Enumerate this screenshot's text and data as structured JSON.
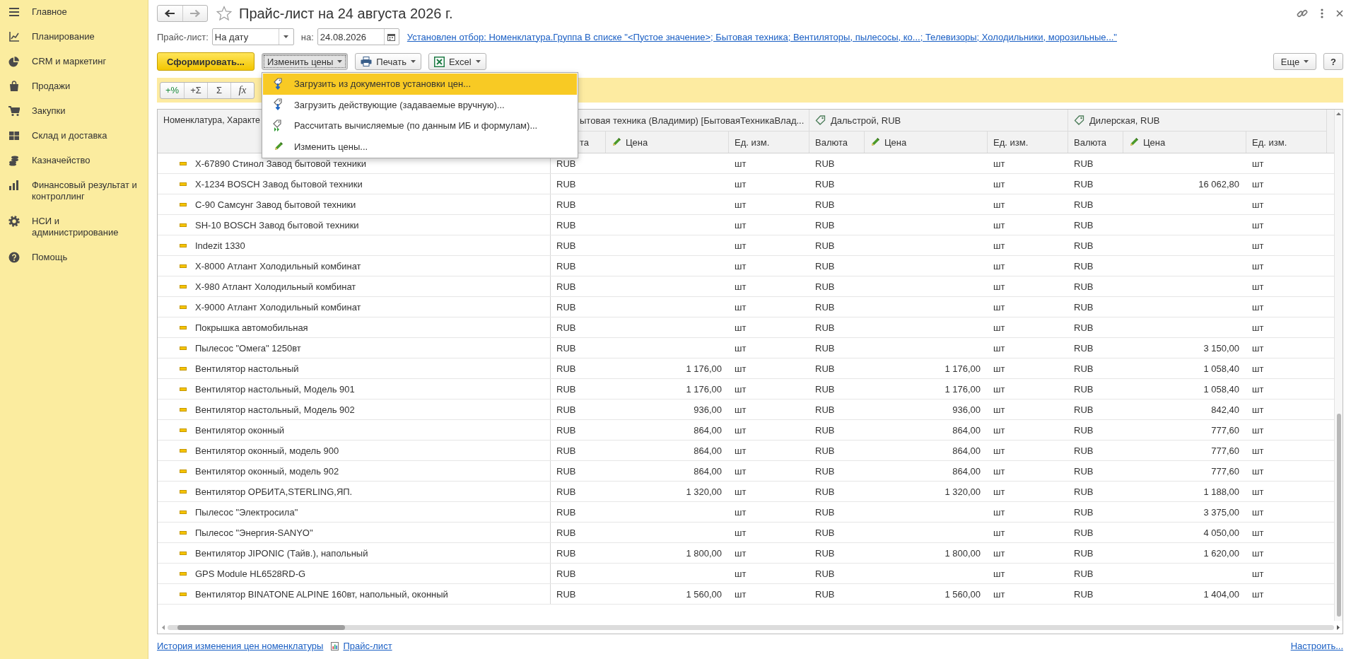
{
  "sidebar": {
    "items": [
      {
        "label": "Главное",
        "selected": false
      },
      {
        "label": "Планирование",
        "selected": false
      },
      {
        "label": "CRM и маркетинг",
        "selected": false
      },
      {
        "label": "Продажи",
        "selected": false
      },
      {
        "label": "Закупки",
        "selected": false
      },
      {
        "label": "Склад и доставка",
        "selected": false
      },
      {
        "label": "Казначейство",
        "selected": false
      },
      {
        "label": "Финансовый результат и контроллинг",
        "selected": false
      },
      {
        "label": "НСИ и администрирование",
        "selected": false
      },
      {
        "label": "Помощь",
        "selected": false
      }
    ]
  },
  "form": {
    "nav": [
      {
        "kind": "back",
        "disabled": false
      },
      {
        "kind": "forward",
        "disabled": true
      }
    ],
    "favorite": false,
    "title": "Прайс-лист на 24 августа 2026 г.",
    "filter": {
      "label": "Прайс-лист:",
      "value": "На дату",
      "date_label": "на:",
      "date": "24.08.2026",
      "link": "Установлен отбор: Номенклатура.Группа В списке \"<Пустое значение>; Бытовая техника; Вентиляторы, пылесосы, ко...; Телевизоры; Холодильники, морозильные...\""
    },
    "toolbar": [
      {
        "kind": "primary",
        "label": "Сформировать...",
        "pressed": false
      },
      {
        "kind": "menu",
        "label": "Изменить цены",
        "pressed": true
      },
      {
        "kind": "print",
        "label": "Печать",
        "pressed": false
      },
      {
        "kind": "excel",
        "label": "Excel",
        "pressed": false
      }
    ],
    "toolbar_right": [
      {
        "kind": "menu",
        "label": "Еще",
        "pressed": false
      },
      {
        "kind": "plain",
        "label": "?",
        "pressed": false
      }
    ],
    "calc_buttons": [
      {
        "kind": "percent",
        "label": "+%"
      },
      {
        "kind": "sum",
        "label": "+Σ"
      },
      {
        "kind": "sum",
        "label": "Σ"
      },
      {
        "kind": "formula",
        "label": "fx"
      }
    ]
  },
  "table": {
    "name_header": "Номенклатура, Характе",
    "groups": [
      {
        "title": "ытовая техника (Владимир) [БытоваяТехникаВлад...",
        "icon": false,
        "columns": [
          "та",
          "Цена",
          "Ед. изм."
        ]
      },
      {
        "title": "Дальстрой, RUB",
        "icon": true,
        "columns": [
          "Валюта",
          "Цена",
          "Ед. изм."
        ]
      },
      {
        "title": "Дилерская, RUB",
        "icon": true,
        "columns": [
          "Валюта",
          "Цена",
          "Ед. изм."
        ]
      }
    ],
    "rows": [
      {
        "name": "X-67890 Стинол Завод бытовой техники",
        "prices": [
          {
            "currency": "RUB",
            "unit": "шт"
          },
          {
            "currency": "RUB",
            "unit": "шт"
          },
          {
            "currency": "RUB",
            "unit": "шт"
          }
        ]
      },
      {
        "name": "X-1234 BOSCH Завод бытовой техники",
        "prices": [
          {
            "currency": "RUB",
            "unit": "шт"
          },
          {
            "currency": "RUB",
            "unit": "шт"
          },
          {
            "currency": "RUB",
            "price": "16 062,80",
            "unit": "шт"
          }
        ]
      },
      {
        "name": "C-90 Самсунг Завод бытовой техники",
        "prices": [
          {
            "currency": "RUB",
            "unit": "шт"
          },
          {
            "currency": "RUB",
            "unit": "шт"
          },
          {
            "currency": "RUB",
            "unit": "шт"
          }
        ]
      },
      {
        "name": "SH-10 BOSCH Завод бытовой техники",
        "prices": [
          {
            "currency": "RUB",
            "unit": "шт"
          },
          {
            "currency": "RUB",
            "unit": "шт"
          },
          {
            "currency": "RUB",
            "unit": "шт"
          }
        ]
      },
      {
        "name": "Indezit 1330",
        "prices": [
          {
            "currency": "RUB",
            "unit": "шт"
          },
          {
            "currency": "RUB",
            "unit": "шт"
          },
          {
            "currency": "RUB",
            "unit": "шт"
          }
        ]
      },
      {
        "name": "X-8000 Атлант Холодильный комбинат",
        "prices": [
          {
            "currency": "RUB",
            "unit": "шт"
          },
          {
            "currency": "RUB",
            "unit": "шт"
          },
          {
            "currency": "RUB",
            "unit": "шт"
          }
        ]
      },
      {
        "name": "X-980 Атлант Холодильный комбинат",
        "prices": [
          {
            "currency": "RUB",
            "unit": "шт"
          },
          {
            "currency": "RUB",
            "unit": "шт"
          },
          {
            "currency": "RUB",
            "unit": "шт"
          }
        ]
      },
      {
        "name": "X-9000 Атлант Холодильный комбинат",
        "prices": [
          {
            "currency": "RUB",
            "unit": "шт"
          },
          {
            "currency": "RUB",
            "unit": "шт"
          },
          {
            "currency": "RUB",
            "unit": "шт"
          }
        ]
      },
      {
        "name": "Покрышка автомобильная",
        "prices": [
          {
            "currency": "RUB",
            "unit": "шт"
          },
          {
            "currency": "RUB",
            "unit": "шт"
          },
          {
            "currency": "RUB",
            "unit": "шт"
          }
        ]
      },
      {
        "name": "Пылесос \"Омега\" 1250вт",
        "prices": [
          {
            "currency": "RUB",
            "unit": "шт"
          },
          {
            "currency": "RUB",
            "unit": "шт"
          },
          {
            "currency": "RUB",
            "price": "3 150,00",
            "unit": "шт"
          }
        ]
      },
      {
        "name": "Вентилятор настольный",
        "prices": [
          {
            "currency": "RUB",
            "price": "1 176,00",
            "unit": "шт"
          },
          {
            "currency": "RUB",
            "price": "1 176,00",
            "unit": "шт"
          },
          {
            "currency": "RUB",
            "price": "1 058,40",
            "unit": "шт"
          }
        ]
      },
      {
        "name": "Вентилятор настольный, Модель 901",
        "prices": [
          {
            "currency": "RUB",
            "price": "1 176,00",
            "unit": "шт"
          },
          {
            "currency": "RUB",
            "price": "1 176,00",
            "unit": "шт"
          },
          {
            "currency": "RUB",
            "price": "1 058,40",
            "unit": "шт"
          }
        ]
      },
      {
        "name": "Вентилятор настольный, Модель 902",
        "prices": [
          {
            "currency": "RUB",
            "price": "936,00",
            "unit": "шт"
          },
          {
            "currency": "RUB",
            "price": "936,00",
            "unit": "шт"
          },
          {
            "currency": "RUB",
            "price": "842,40",
            "unit": "шт"
          }
        ]
      },
      {
        "name": "Вентилятор оконный",
        "prices": [
          {
            "currency": "RUB",
            "price": "864,00",
            "unit": "шт"
          },
          {
            "currency": "RUB",
            "price": "864,00",
            "unit": "шт"
          },
          {
            "currency": "RUB",
            "price": "777,60",
            "unit": "шт"
          }
        ]
      },
      {
        "name": "Вентилятор оконный, модель 900",
        "prices": [
          {
            "currency": "RUB",
            "price": "864,00",
            "unit": "шт"
          },
          {
            "currency": "RUB",
            "price": "864,00",
            "unit": "шт"
          },
          {
            "currency": "RUB",
            "price": "777,60",
            "unit": "шт"
          }
        ]
      },
      {
        "name": "Вентилятор оконный, модель 902",
        "prices": [
          {
            "currency": "RUB",
            "price": "864,00",
            "unit": "шт"
          },
          {
            "currency": "RUB",
            "price": "864,00",
            "unit": "шт"
          },
          {
            "currency": "RUB",
            "price": "777,60",
            "unit": "шт"
          }
        ]
      },
      {
        "name": "Вентилятор ОРБИТА,STERLING,ЯП.",
        "prices": [
          {
            "currency": "RUB",
            "price": "1 320,00",
            "unit": "шт"
          },
          {
            "currency": "RUB",
            "price": "1 320,00",
            "unit": "шт"
          },
          {
            "currency": "RUB",
            "price": "1 188,00",
            "unit": "шт"
          }
        ]
      },
      {
        "name": "Пылесос \"Электросила\"",
        "prices": [
          {
            "currency": "RUB",
            "unit": "шт"
          },
          {
            "currency": "RUB",
            "unit": "шт"
          },
          {
            "currency": "RUB",
            "price": "3 375,00",
            "unit": "шт"
          }
        ]
      },
      {
        "name": "Пылесос \"Энергия-SANYO\"",
        "prices": [
          {
            "currency": "RUB",
            "unit": "шт"
          },
          {
            "currency": "RUB",
            "unit": "шт"
          },
          {
            "currency": "RUB",
            "price": "4 050,00",
            "unit": "шт"
          }
        ]
      },
      {
        "name": "Вентилятор JIPONIC (Тайв.), напольный",
        "prices": [
          {
            "currency": "RUB",
            "price": "1 800,00",
            "unit": "шт"
          },
          {
            "currency": "RUB",
            "price": "1 800,00",
            "unit": "шт"
          },
          {
            "currency": "RUB",
            "price": "1 620,00",
            "unit": "шт"
          }
        ]
      },
      {
        "name": "GPS Module HL6528RD-G",
        "prices": [
          {
            "currency": "RUB",
            "unit": "шт"
          },
          {
            "currency": "RUB",
            "unit": "шт"
          },
          {
            "currency": "RUB",
            "unit": "шт"
          }
        ]
      },
      {
        "name": "Вентилятор BINATONE ALPINE 160вт, напольный, оконный",
        "prices": [
          {
            "currency": "RUB",
            "price": "1 560,00",
            "unit": "шт"
          },
          {
            "currency": "RUB",
            "price": "1 560,00",
            "unit": "шт"
          },
          {
            "currency": "RUB",
            "price": "1 404,00",
            "unit": "шт"
          }
        ]
      }
    ]
  },
  "menu": {
    "items": [
      {
        "kind": "load",
        "label": "Загрузить из документов установки цен...",
        "selected": true
      },
      {
        "kind": "load",
        "label": "Загрузить действующие (задаваемые вручную)...",
        "selected": false
      },
      {
        "kind": "calculate",
        "label": "Рассчитать вычисляемые (по данным ИБ и формулам)...",
        "selected": false
      },
      {
        "kind": "edit",
        "label": "Изменить цены...",
        "selected": false
      }
    ]
  },
  "footer": {
    "links": [
      {
        "kind": "link",
        "label": "История изменения цен номенклатуры"
      },
      {
        "kind": "report",
        "label": "Прайс-лист"
      }
    ],
    "settings": "Настроить..."
  }
}
